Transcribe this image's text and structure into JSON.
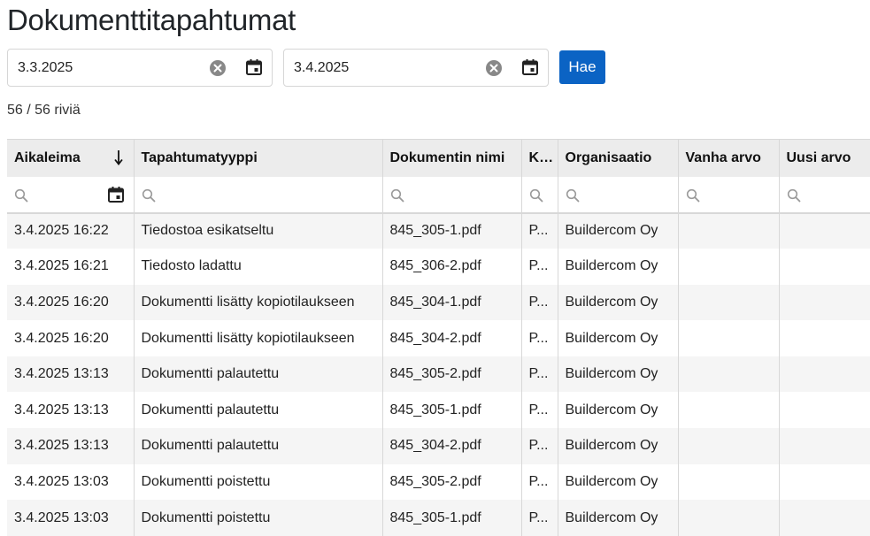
{
  "page": {
    "title": "Dokumenttitapahtumat"
  },
  "filters": {
    "start_date": "3.3.2025",
    "end_date": "3.4.2025",
    "search_label": "Hae"
  },
  "row_count": "56 / 56 riviä",
  "table": {
    "columns": [
      "Aikaleima",
      "Tapahtumatyyppi",
      "Dokumentin nimi",
      "K...",
      "Organisaatio",
      "Vanha arvo",
      "Uusi arvo"
    ],
    "sort": {
      "column": "Aikaleima",
      "direction": "descending"
    },
    "rows": [
      [
        "3.4.2025 16:22",
        "Tiedostoa esikatseltu",
        "845_305-1.pdf",
        "P...",
        "Buildercom Oy",
        "",
        ""
      ],
      [
        "3.4.2025 16:21",
        "Tiedosto ladattu",
        "845_306-2.pdf",
        "P...",
        "Buildercom Oy",
        "",
        ""
      ],
      [
        "3.4.2025 16:20",
        "Dokumentti lisätty kopiotilaukseen",
        "845_304-1.pdf",
        "P...",
        "Buildercom Oy",
        "",
        ""
      ],
      [
        "3.4.2025 16:20",
        "Dokumentti lisätty kopiotilaukseen",
        "845_304-2.pdf",
        "P...",
        "Buildercom Oy",
        "",
        ""
      ],
      [
        "3.4.2025 13:13",
        "Dokumentti palautettu",
        "845_305-2.pdf",
        "P...",
        "Buildercom Oy",
        "",
        ""
      ],
      [
        "3.4.2025 13:13",
        "Dokumentti palautettu",
        "845_305-1.pdf",
        "P...",
        "Buildercom Oy",
        "",
        ""
      ],
      [
        "3.4.2025 13:13",
        "Dokumentti palautettu",
        "845_304-2.pdf",
        "P...",
        "Buildercom Oy",
        "",
        ""
      ],
      [
        "3.4.2025 13:03",
        "Dokumentti poistettu",
        "845_305-2.pdf",
        "P...",
        "Buildercom Oy",
        "",
        ""
      ],
      [
        "3.4.2025 13:03",
        "Dokumentti poistettu",
        "845_305-1.pdf",
        "P...",
        "Buildercom Oy",
        "",
        ""
      ]
    ]
  },
  "icons": {
    "clear": "clear-circle-icon",
    "calendar": "calendar-icon",
    "search": "magnifier-icon",
    "sort": "arrow-down-icon"
  },
  "colors": {
    "primary_button": "#0b63c4",
    "header_bg": "#ececec",
    "stripe_bg": "#f5f5f5"
  }
}
